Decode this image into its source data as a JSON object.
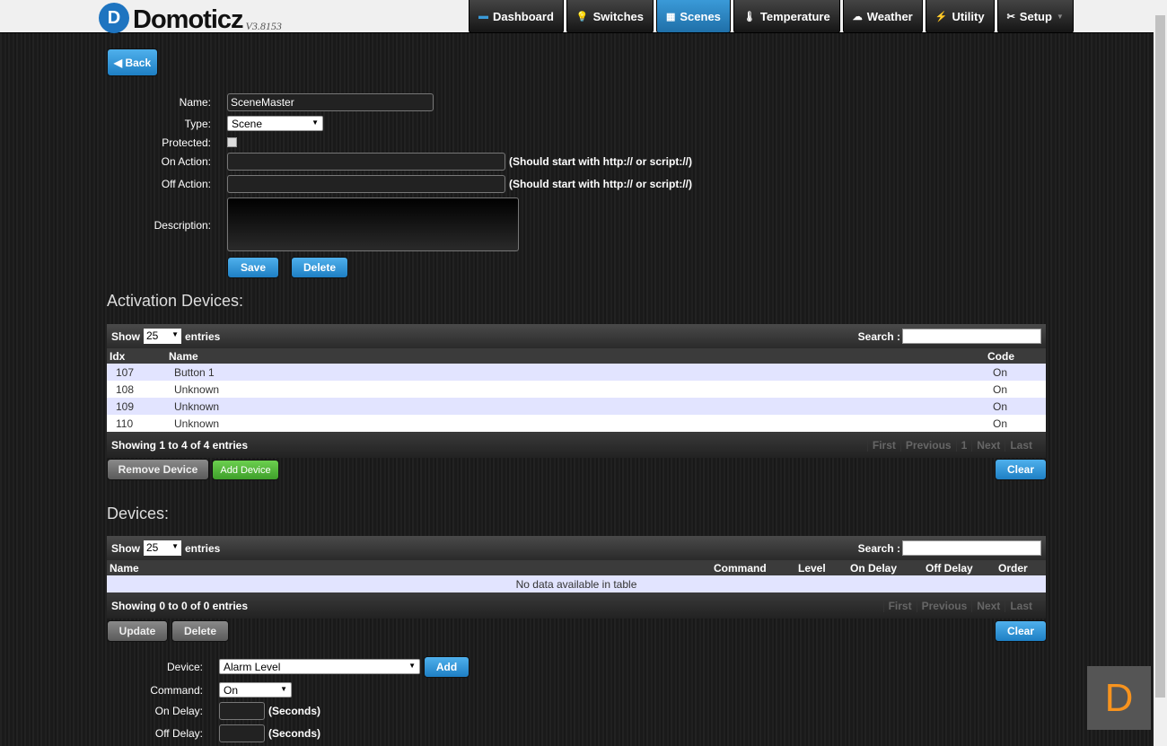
{
  "app": {
    "logo_letter": "D",
    "name": "Domoticz",
    "version": "V3.8153"
  },
  "nav": [
    {
      "label": "Dashboard",
      "icon": "dashboard-icon",
      "glyph": "▬"
    },
    {
      "label": "Switches",
      "icon": "lightbulb-icon",
      "glyph": "💡"
    },
    {
      "label": "Scenes",
      "icon": "scenes-icon",
      "glyph": "▦"
    },
    {
      "label": "Temperature",
      "icon": "thermometer-icon",
      "glyph": "🌡"
    },
    {
      "label": "Weather",
      "icon": "weather-icon",
      "glyph": "☁"
    },
    {
      "label": "Utility",
      "icon": "utility-icon",
      "glyph": "⚡"
    },
    {
      "label": "Setup",
      "icon": "tools-icon",
      "glyph": "✂"
    }
  ],
  "back_label": "◀ Back",
  "form": {
    "name_label": "Name:",
    "name_value": "SceneMaster",
    "type_label": "Type:",
    "type_value": "Scene",
    "protected_label": "Protected:",
    "on_action_label": "On Action:",
    "off_action_label": "Off Action:",
    "action_hint": "(Should start with http:// or script://)",
    "description_label": "Description:",
    "save": "Save",
    "delete": "Delete"
  },
  "activation": {
    "title": "Activation Devices:",
    "show": "Show",
    "entries_count": "25",
    "entries": "entries",
    "search": "Search :",
    "cols": [
      "Idx",
      "Name",
      "Code"
    ],
    "rows": [
      {
        "idx": "107",
        "name": "Button 1",
        "code": "On"
      },
      {
        "idx": "108",
        "name": "Unknown",
        "code": "On"
      },
      {
        "idx": "109",
        "name": "Unknown",
        "code": "On"
      },
      {
        "idx": "110",
        "name": "Unknown",
        "code": "On"
      }
    ],
    "info": "Showing 1 to 4 of 4 entries",
    "pager": [
      "First",
      "Previous",
      "1",
      "Next",
      "Last"
    ],
    "remove": "Remove Device",
    "add": "Add Device",
    "clear": "Clear"
  },
  "devices": {
    "title": "Devices:",
    "show": "Show",
    "entries_count": "25",
    "entries": "entries",
    "search": "Search :",
    "cols": [
      "Name",
      "Command",
      "Level",
      "On Delay",
      "Off Delay",
      "Order"
    ],
    "empty": "No data available in table",
    "info": "Showing 0 to 0 of 0 entries",
    "pager": [
      "First",
      "Previous",
      "Next",
      "Last"
    ],
    "update": "Update",
    "delete": "Delete",
    "clear": "Clear"
  },
  "add_form": {
    "device_label": "Device:",
    "device_value": "Alarm Level",
    "add": "Add",
    "command_label": "Command:",
    "command_value": "On",
    "on_delay_label": "On Delay:",
    "off_delay_label": "Off Delay:",
    "seconds": "(Seconds)"
  },
  "badge_letter": "D"
}
